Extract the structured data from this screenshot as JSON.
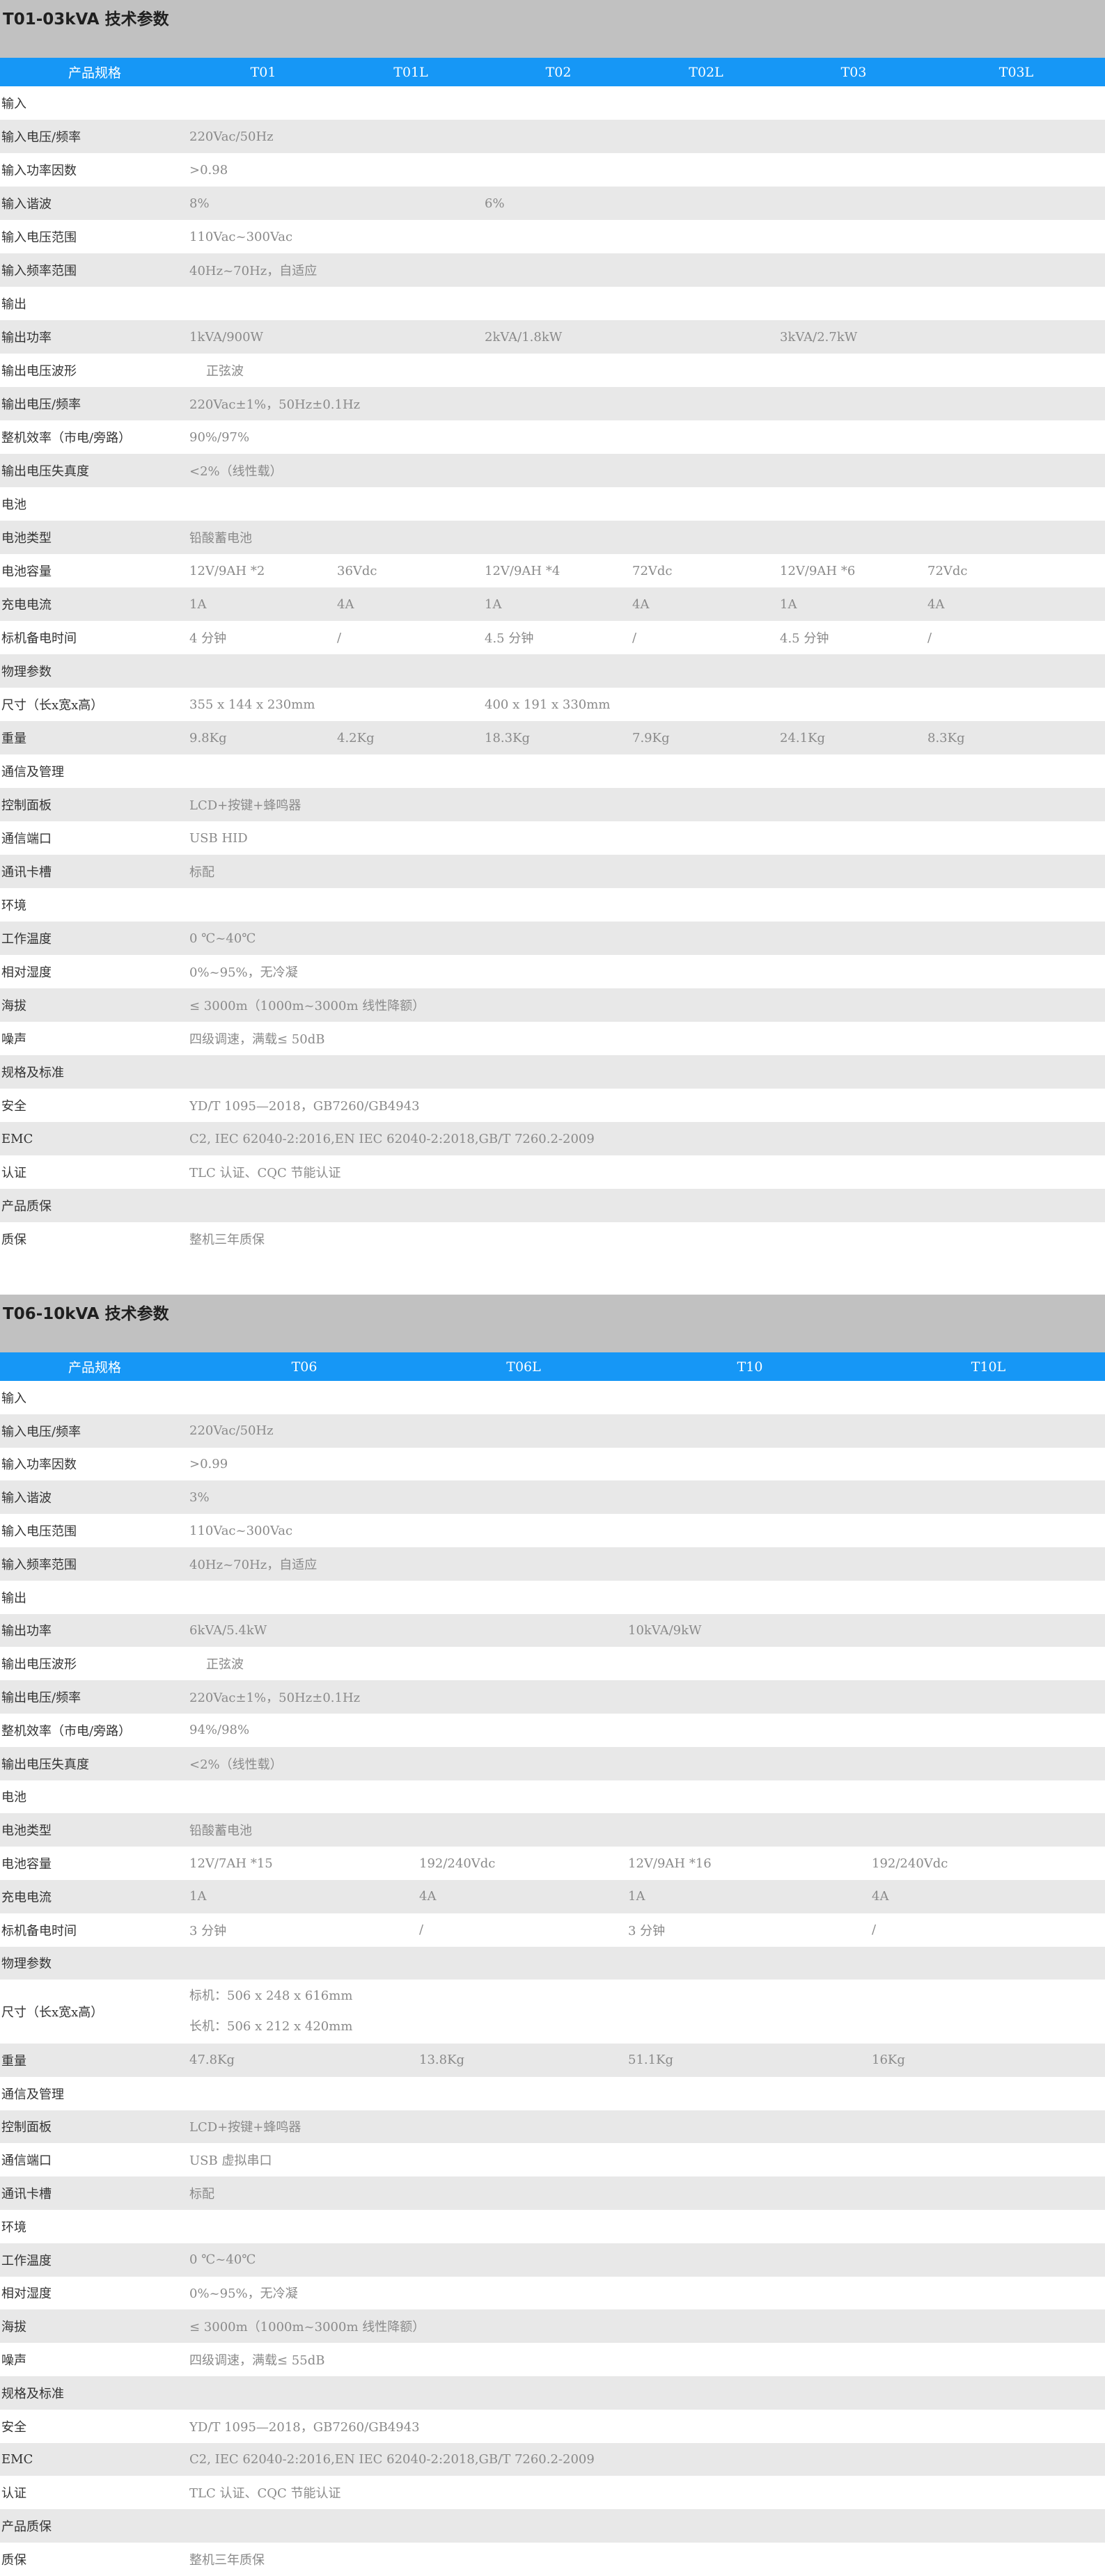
{
  "sections": [
    {
      "title": "T01-03kVA 技术参数",
      "headers": [
        "产品规格",
        "T01",
        "T01L",
        "T02",
        "T02L",
        "T03",
        "T03L"
      ],
      "rows": [
        {
          "label": "输入",
          "cells": []
        },
        {
          "label": "输入电压/频率",
          "cells": [
            {
              "text": "220Vac/50Hz",
              "col": 1,
              "span": 6
            }
          ]
        },
        {
          "label": "输入功率因数",
          "cells": [
            {
              "text": ">0.98",
              "col": 1,
              "span": 6
            }
          ]
        },
        {
          "label": "输入谐波",
          "cells": [
            {
              "text": "8%",
              "col": 1,
              "span": 2
            },
            {
              "text": "6%",
              "col": 3,
              "span": 4
            }
          ]
        },
        {
          "label": "输入电压范围",
          "cells": [
            {
              "text": "110Vac~300Vac",
              "col": 1,
              "span": 6
            }
          ]
        },
        {
          "label": "输入频率范围",
          "cells": [
            {
              "text": "40Hz~70Hz，自适应",
              "col": 1,
              "span": 6
            }
          ]
        },
        {
          "label": "输出",
          "cells": []
        },
        {
          "label": "输出功率",
          "cells": [
            {
              "text": "1kVA/900W",
              "col": 1,
              "span": 2
            },
            {
              "text": "2kVA/1.8kW",
              "col": 3,
              "span": 2
            },
            {
              "text": "3kVA/2.7kW",
              "col": 5,
              "span": 2
            }
          ]
        },
        {
          "label": "输出电压波形",
          "cells": [
            {
              "text": "正弦波",
              "col": 1,
              "span": 6,
              "indent": true
            }
          ]
        },
        {
          "label": "输出电压/频率",
          "cells": [
            {
              "text": "220Vac±1%，50Hz±0.1Hz",
              "col": 1,
              "span": 6
            }
          ]
        },
        {
          "label": "整机效率（市电/旁路）",
          "cells": [
            {
              "text": "90%/97%",
              "col": 1,
              "span": 6
            }
          ]
        },
        {
          "label": "输出电压失真度",
          "cells": [
            {
              "text": "<2%（线性载）",
              "col": 1,
              "span": 6
            }
          ]
        },
        {
          "label": "电池",
          "cells": []
        },
        {
          "label": "电池类型",
          "cells": [
            {
              "text": "铅酸蓄电池",
              "col": 1,
              "span": 6
            }
          ]
        },
        {
          "label": "电池容量",
          "cells": [
            {
              "text": "12V/9AH *2",
              "col": 1,
              "span": 1
            },
            {
              "text": "36Vdc",
              "col": 2,
              "span": 1
            },
            {
              "text": "12V/9AH *4",
              "col": 3,
              "span": 1
            },
            {
              "text": "72Vdc",
              "col": 4,
              "span": 1
            },
            {
              "text": "12V/9AH *6",
              "col": 5,
              "span": 1
            },
            {
              "text": "72Vdc",
              "col": 6,
              "span": 1
            }
          ]
        },
        {
          "label": "充电电流",
          "cells": [
            {
              "text": "1A",
              "col": 1,
              "span": 1
            },
            {
              "text": "4A",
              "col": 2,
              "span": 1
            },
            {
              "text": "1A",
              "col": 3,
              "span": 1
            },
            {
              "text": "4A",
              "col": 4,
              "span": 1
            },
            {
              "text": "1A",
              "col": 5,
              "span": 1
            },
            {
              "text": "4A",
              "col": 6,
              "span": 1
            }
          ]
        },
        {
          "label": "标机备电时间",
          "cells": [
            {
              "text": "4 分钟",
              "col": 1,
              "span": 1
            },
            {
              "text": "/",
              "col": 2,
              "span": 1
            },
            {
              "text": "4.5 分钟",
              "col": 3,
              "span": 1
            },
            {
              "text": "/",
              "col": 4,
              "span": 1
            },
            {
              "text": "4.5 分钟",
              "col": 5,
              "span": 1
            },
            {
              "text": "/",
              "col": 6,
              "span": 1
            }
          ]
        },
        {
          "label": "物理参数",
          "cells": []
        },
        {
          "label": "尺寸（长x宽x高）",
          "cells": [
            {
              "text": "355 x 144 x 230mm",
              "col": 1,
              "span": 2
            },
            {
              "text": "400 x 191 x 330mm",
              "col": 3,
              "span": 4
            }
          ]
        },
        {
          "label": "重量",
          "cells": [
            {
              "text": "9.8Kg",
              "col": 1,
              "span": 1
            },
            {
              "text": "4.2Kg",
              "col": 2,
              "span": 1
            },
            {
              "text": "18.3Kg",
              "col": 3,
              "span": 1
            },
            {
              "text": "7.9Kg",
              "col": 4,
              "span": 1
            },
            {
              "text": "24.1Kg",
              "col": 5,
              "span": 1
            },
            {
              "text": "8.3Kg",
              "col": 6,
              "span": 1
            }
          ]
        },
        {
          "label": "通信及管理",
          "cells": []
        },
        {
          "label": "控制面板",
          "cells": [
            {
              "text": "LCD+按键+蜂鸣器",
              "col": 1,
              "span": 6
            }
          ]
        },
        {
          "label": "通信端口",
          "cells": [
            {
              "text": "USB HID",
              "col": 1,
              "span": 6
            }
          ]
        },
        {
          "label": "通讯卡槽",
          "cells": [
            {
              "text": "标配",
              "col": 1,
              "span": 6
            }
          ]
        },
        {
          "label": "环境",
          "cells": []
        },
        {
          "label": "工作温度",
          "cells": [
            {
              "text": "0 ℃~40℃",
              "col": 1,
              "span": 6
            }
          ]
        },
        {
          "label": "相对湿度",
          "cells": [
            {
              "text": "0%~95%，无冷凝",
              "col": 1,
              "span": 6
            }
          ]
        },
        {
          "label": "海拔",
          "cells": [
            {
              "text": "≤ 3000m（1000m~3000m 线性降额）",
              "col": 1,
              "span": 6
            }
          ]
        },
        {
          "label": "噪声",
          "cells": [
            {
              "text": "四级调速，满载≤ 50dB",
              "col": 1,
              "span": 6
            }
          ]
        },
        {
          "label": "规格及标准",
          "cells": []
        },
        {
          "label": "安全",
          "cells": [
            {
              "text": "YD/T 1095—2018，GB7260/GB4943",
              "col": 1,
              "span": 6
            }
          ]
        },
        {
          "label": "EMC",
          "cells": [
            {
              "text": "C2, IEC 62040-2:2016,EN IEC 62040-2:2018,GB/T 7260.2-2009",
              "col": 1,
              "span": 6
            }
          ]
        },
        {
          "label": "认证",
          "cells": [
            {
              "text": "TLC 认证、CQC 节能认证",
              "col": 1,
              "span": 6
            }
          ]
        },
        {
          "label": "产品质保",
          "cells": []
        },
        {
          "label": "质保",
          "cells": [
            {
              "text": "整机三年质保",
              "col": 1,
              "span": 6
            }
          ]
        }
      ]
    },
    {
      "title": "T06-10kVA 技术参数",
      "headers": [
        "产品规格",
        "T06",
        "T06L",
        "T10",
        "T10L"
      ],
      "rows": [
        {
          "label": "输入",
          "cells": []
        },
        {
          "label": "输入电压/频率",
          "cells": [
            {
              "text": "220Vac/50Hz",
              "col": 1,
              "span": 4
            }
          ]
        },
        {
          "label": "输入功率因数",
          "cells": [
            {
              "text": ">0.99",
              "col": 1,
              "span": 4
            }
          ]
        },
        {
          "label": "输入谐波",
          "cells": [
            {
              "text": "3%",
              "col": 1,
              "span": 4
            }
          ]
        },
        {
          "label": "输入电压范围",
          "cells": [
            {
              "text": "110Vac~300Vac",
              "col": 1,
              "span": 4
            }
          ]
        },
        {
          "label": "输入频率范围",
          "cells": [
            {
              "text": "40Hz~70Hz，自适应",
              "col": 1,
              "span": 4
            }
          ]
        },
        {
          "label": "输出",
          "cells": []
        },
        {
          "label": "输出功率",
          "cells": [
            {
              "text": "6kVA/5.4kW",
              "col": 1,
              "span": 2
            },
            {
              "text": "10kVA/9kW",
              "col": 3,
              "span": 2
            }
          ]
        },
        {
          "label": "输出电压波形",
          "cells": [
            {
              "text": "正弦波",
              "col": 1,
              "span": 4,
              "indent": true
            }
          ]
        },
        {
          "label": "输出电压/频率",
          "cells": [
            {
              "text": "220Vac±1%，50Hz±0.1Hz",
              "col": 1,
              "span": 4
            }
          ]
        },
        {
          "label": "整机效率（市电/旁路）",
          "cells": [
            {
              "text": "94%/98%",
              "col": 1,
              "span": 4
            }
          ]
        },
        {
          "label": "输出电压失真度",
          "cells": [
            {
              "text": "<2%（线性载）",
              "col": 1,
              "span": 4
            }
          ]
        },
        {
          "label": "电池",
          "cells": []
        },
        {
          "label": "电池类型",
          "cells": [
            {
              "text": "铅酸蓄电池",
              "col": 1,
              "span": 4
            }
          ]
        },
        {
          "label": "电池容量",
          "cells": [
            {
              "text": "12V/7AH *15",
              "col": 1,
              "span": 1
            },
            {
              "text": "192/240Vdc",
              "col": 2,
              "span": 1
            },
            {
              "text": "12V/9AH *16",
              "col": 3,
              "span": 1
            },
            {
              "text": "192/240Vdc",
              "col": 4,
              "span": 1
            }
          ]
        },
        {
          "label": "充电电流",
          "cells": [
            {
              "text": "1A",
              "col": 1,
              "span": 1
            },
            {
              "text": "4A",
              "col": 2,
              "span": 1
            },
            {
              "text": "1A",
              "col": 3,
              "span": 1
            },
            {
              "text": "4A",
              "col": 4,
              "span": 1
            }
          ]
        },
        {
          "label": "标机备电时间",
          "cells": [
            {
              "text": "3 分钟",
              "col": 1,
              "span": 1
            },
            {
              "text": "/",
              "col": 2,
              "span": 1
            },
            {
              "text": "3 分钟",
              "col": 3,
              "span": 1
            },
            {
              "text": "/",
              "col": 4,
              "span": 1
            }
          ]
        },
        {
          "label": "物理参数",
          "cells": []
        },
        {
          "label": "尺寸（长x宽x高）",
          "cells": [
            {
              "lines": [
                "标机：506 x 248 x 616mm",
                "长机：506 x 212 x 420mm"
              ],
              "col": 1,
              "span": 4
            }
          ]
        },
        {
          "label": "重量",
          "cells": [
            {
              "text": "47.8Kg",
              "col": 1,
              "span": 1
            },
            {
              "text": "13.8Kg",
              "col": 2,
              "span": 1
            },
            {
              "text": "51.1Kg",
              "col": 3,
              "span": 1
            },
            {
              "text": "16Kg",
              "col": 4,
              "span": 1
            }
          ]
        },
        {
          "label": "通信及管理",
          "cells": []
        },
        {
          "label": "控制面板",
          "cells": [
            {
              "text": "LCD+按键+蜂鸣器",
              "col": 1,
              "span": 4
            }
          ]
        },
        {
          "label": "通信端口",
          "cells": [
            {
              "text": "USB 虚拟串口",
              "col": 1,
              "span": 4
            }
          ]
        },
        {
          "label": "通讯卡槽",
          "cells": [
            {
              "text": "标配",
              "col": 1,
              "span": 4
            }
          ]
        },
        {
          "label": "环境",
          "cells": []
        },
        {
          "label": "工作温度",
          "cells": [
            {
              "text": "0 ℃~40℃",
              "col": 1,
              "span": 4
            }
          ]
        },
        {
          "label": "相对湿度",
          "cells": [
            {
              "text": "0%~95%，无冷凝",
              "col": 1,
              "span": 4
            }
          ]
        },
        {
          "label": "海拔",
          "cells": [
            {
              "text": "≤ 3000m（1000m~3000m 线性降额）",
              "col": 1,
              "span": 4
            }
          ]
        },
        {
          "label": "噪声",
          "cells": [
            {
              "text": "四级调速，满载≤ 55dB",
              "col": 1,
              "span": 4
            }
          ]
        },
        {
          "label": "规格及标准",
          "cells": []
        },
        {
          "label": "安全",
          "cells": [
            {
              "text": "YD/T 1095—2018，GB7260/GB4943",
              "col": 1,
              "span": 4
            }
          ]
        },
        {
          "label": "EMC",
          "cells": [
            {
              "text": "C2, IEC 62040-2:2016,EN IEC 62040-2:2018,GB/T 7260.2-2009",
              "col": 1,
              "span": 4
            }
          ]
        },
        {
          "label": "认证",
          "cells": [
            {
              "text": "TLC 认证、CQC 节能认证",
              "col": 1,
              "span": 4
            }
          ]
        },
        {
          "label": "产品质保",
          "cells": []
        },
        {
          "label": "质保",
          "cells": [
            {
              "text": "整机三年质保",
              "col": 1,
              "span": 4
            }
          ]
        }
      ]
    }
  ]
}
